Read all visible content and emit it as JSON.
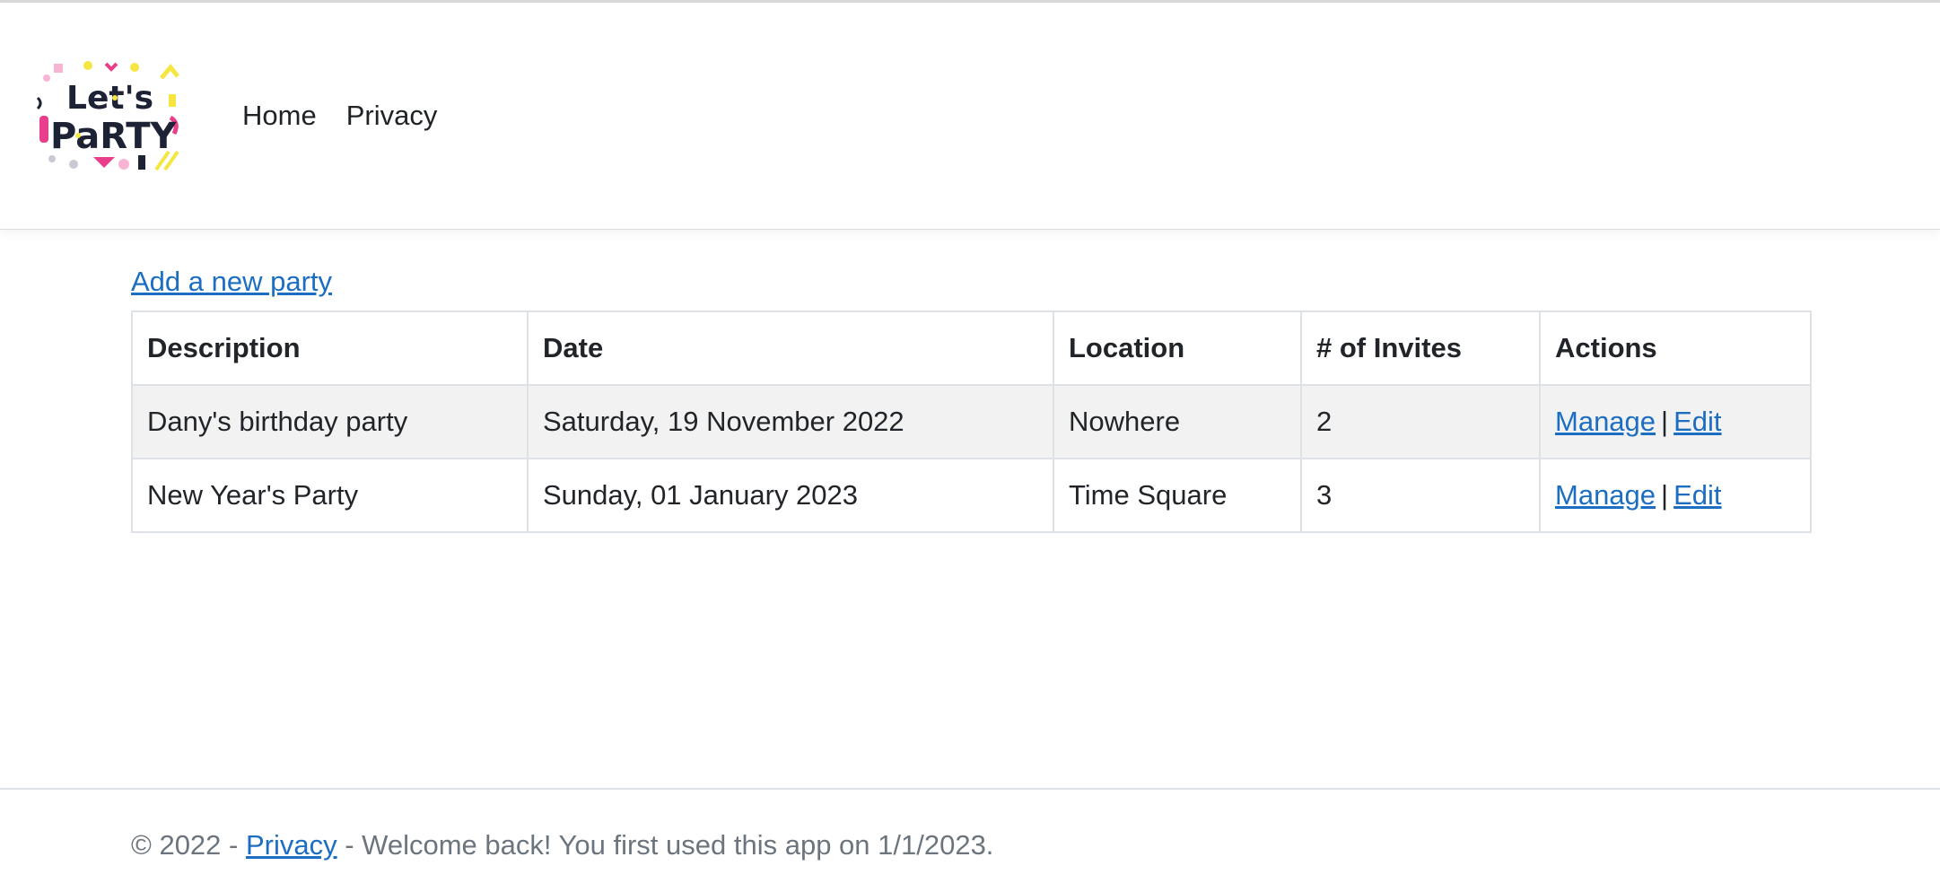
{
  "nav": {
    "logo_alt": "Let's Party",
    "items": [
      {
        "label": "Home"
      },
      {
        "label": "Privacy"
      }
    ]
  },
  "main": {
    "add_link": "Add a new party",
    "table": {
      "headers": [
        "Description",
        "Date",
        "Location",
        "# of Invites",
        "Actions"
      ],
      "rows": [
        {
          "description": "Dany's birthday party",
          "date": "Saturday, 19 November 2022",
          "location": "Nowhere",
          "invites": "2",
          "manage": "Manage",
          "separator": "|",
          "edit": "Edit"
        },
        {
          "description": "New Year's Party",
          "date": "Sunday, 01 January 2023",
          "location": "Time Square",
          "invites": "3",
          "manage": "Manage",
          "separator": "|",
          "edit": "Edit"
        }
      ]
    }
  },
  "footer": {
    "prefix": "© 2022 - ",
    "privacy_link": "Privacy",
    "suffix": " - Welcome back! You first used this app on 1/1/2023."
  },
  "colors": {
    "link": "#1b6ec2",
    "stripe": "#f2f2f2",
    "border": "#dee2e6",
    "footer_text": "#6c757d"
  }
}
